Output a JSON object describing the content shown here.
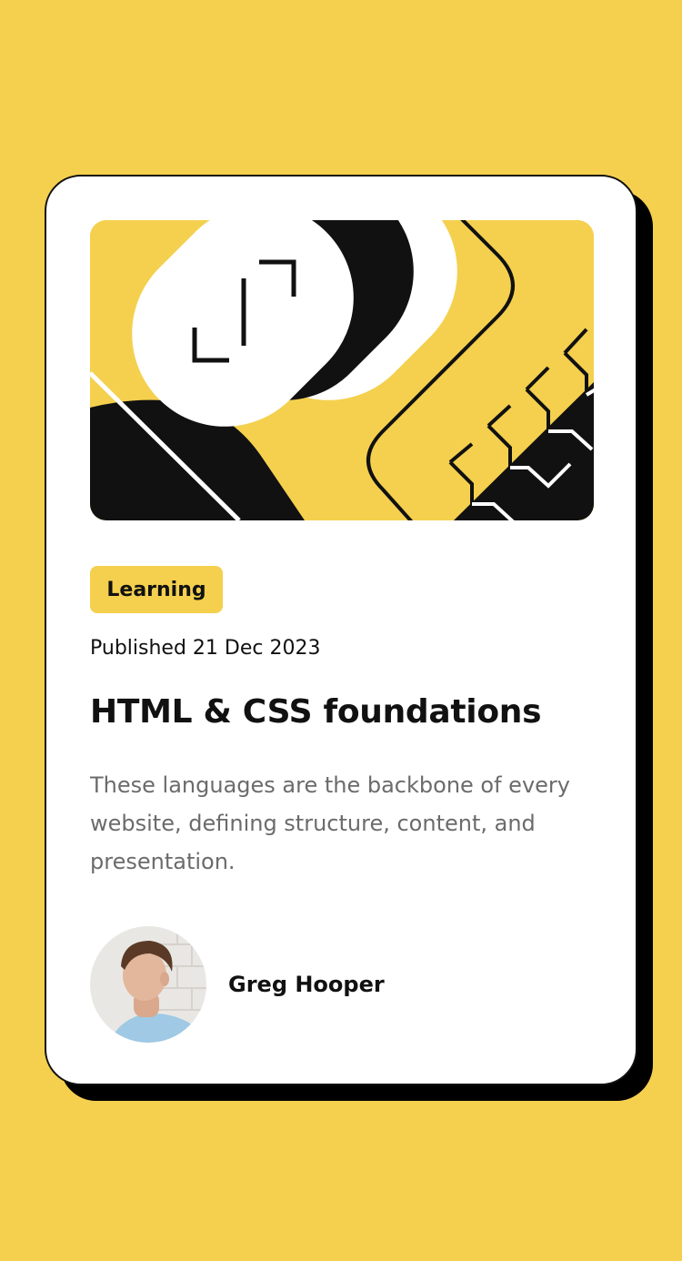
{
  "colors": {
    "background": "#F4D04E",
    "card": "#FFFFFF",
    "ink": "#111111",
    "muted_text": "#6B6B6B"
  },
  "card": {
    "tag": "Learning",
    "published": "Published 21 Dec 2023",
    "title": "HTML & CSS foundations",
    "description": "These languages are the backbone of every website, defining structure, content, and presentation.",
    "author": {
      "name": "Greg Hooper"
    }
  }
}
